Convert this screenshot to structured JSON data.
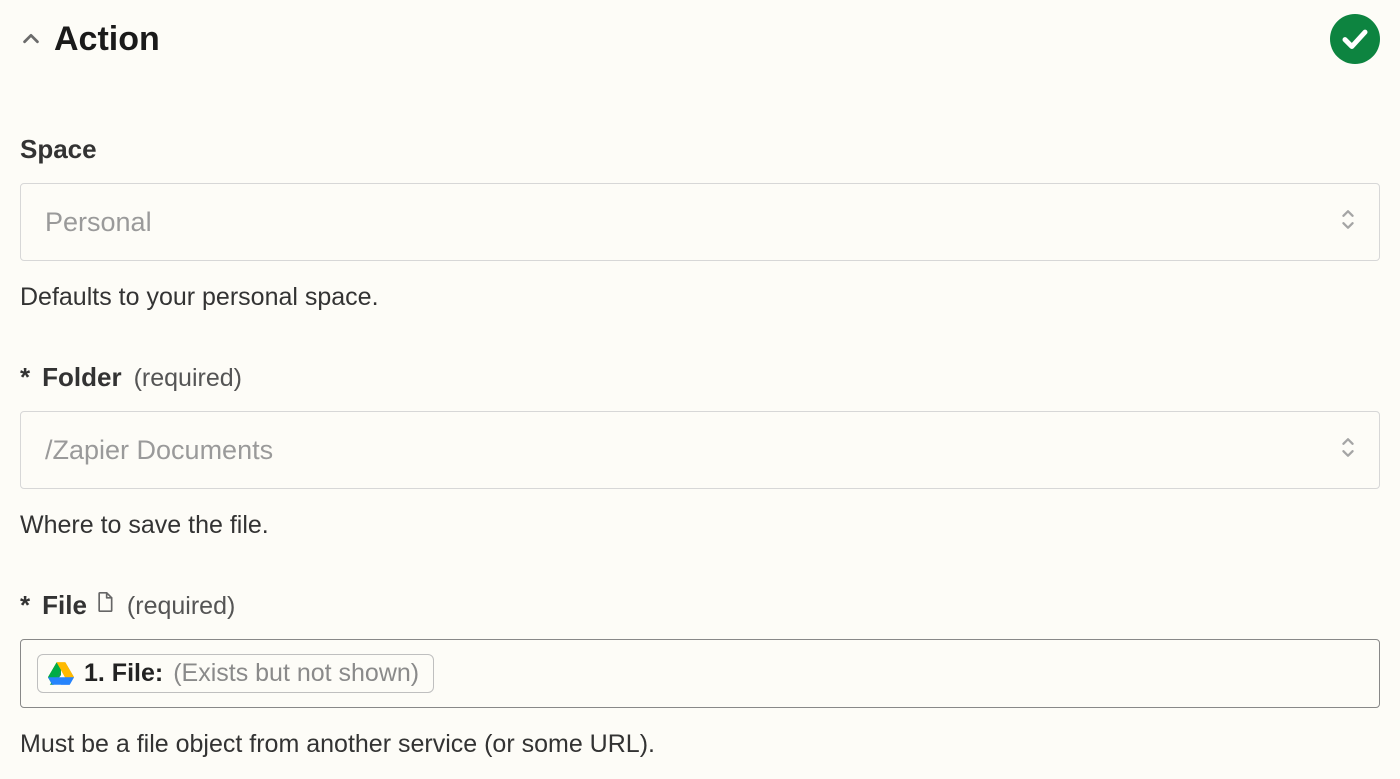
{
  "section": {
    "title": "Action",
    "status_ok": true
  },
  "fields": {
    "space": {
      "label": "Space",
      "placeholder": "Personal",
      "help": "Defaults to your personal space."
    },
    "folder": {
      "asterisk": "*",
      "label": "Folder",
      "required_note": "(required)",
      "placeholder": "/Zapier Documents",
      "help": "Where to save the file."
    },
    "file": {
      "asterisk": "*",
      "label": "File",
      "required_note": "(required)",
      "pill_prefix": "1. File:",
      "pill_suffix": "(Exists but not shown)",
      "help": "Must be a file object from another service (or some URL)."
    }
  }
}
